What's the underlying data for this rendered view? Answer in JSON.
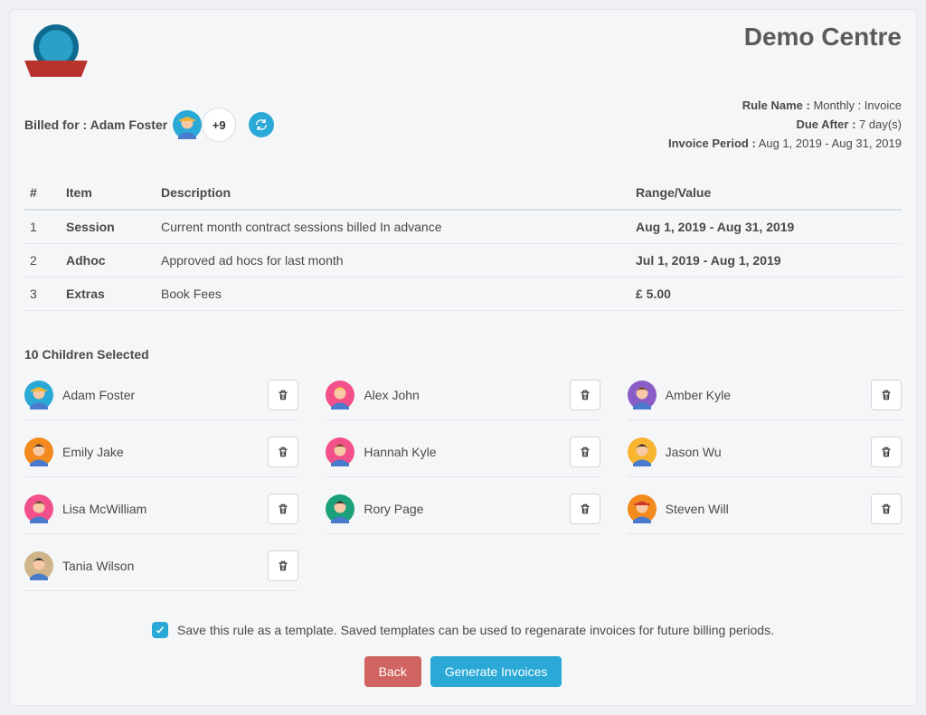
{
  "header": {
    "centre_title": "Demo Centre"
  },
  "billed": {
    "label": "Billed for :",
    "name": "Adam Foster",
    "more_count": "+9"
  },
  "meta": {
    "rule_name_label": "Rule Name :",
    "rule_name_value": "Monthly : Invoice",
    "due_after_label": "Due After :",
    "due_after_value": "7 day(s)",
    "invoice_period_label": "Invoice Period :",
    "invoice_period_value": "Aug 1, 2019 - Aug 31, 2019"
  },
  "table": {
    "headers": {
      "num": "#",
      "item": "Item",
      "description": "Description",
      "range": "Range/Value"
    },
    "rows": [
      {
        "num": "1",
        "item": "Session",
        "desc": "Current month contract sessions billed In advance",
        "range": "Aug 1, 2019 - Aug 31, 2019"
      },
      {
        "num": "2",
        "item": "Adhoc",
        "desc": "Approved ad hocs for last month",
        "range": "Jul 1, 2019 - Aug 1, 2019"
      },
      {
        "num": "3",
        "item": "Extras",
        "desc": "Book Fees",
        "range": "£ 5.00"
      }
    ]
  },
  "children": {
    "title": "10 Children Selected",
    "list": [
      {
        "name": "Adam Foster",
        "bg": "#2aa8d6",
        "hair": "#3a2a1c",
        "hat": "#f7b531"
      },
      {
        "name": "Alex John",
        "bg": "#f2508a",
        "hair": "#f7c94f"
      },
      {
        "name": "Amber Kyle",
        "bg": "#8a5cc7",
        "hair": "#6a3d20"
      },
      {
        "name": "Emily Jake",
        "bg": "#f28a1e",
        "hair": "#3a2a1c"
      },
      {
        "name": "Hannah Kyle",
        "bg": "#f2508a",
        "hair": "#6a3d20"
      },
      {
        "name": "Jason Wu",
        "bg": "#f7b531",
        "hair": "#3a2a1c"
      },
      {
        "name": "Lisa McWilliam",
        "bg": "#f2508a",
        "hair": "#6a3d20"
      },
      {
        "name": "Rory Page",
        "bg": "#1aa07a",
        "hair": "#2a2a2a"
      },
      {
        "name": "Steven Will",
        "bg": "#f28a1e",
        "hair": "#3a2a1c",
        "hat": "#d0392e"
      },
      {
        "name": "Tania Wilson",
        "bg": "#d0b48a",
        "hair": "#2a2a2a"
      }
    ]
  },
  "footer": {
    "checkbox_label": "Save this rule as a template. Saved templates can be used to regenarate invoices for future billing periods.",
    "back_label": "Back",
    "generate_label": "Generate Invoices"
  },
  "avatar_colors": {
    "default": {
      "bg": "#2aa8d6",
      "hair": "#3a2a1c",
      "hat": "#f7b531"
    }
  }
}
